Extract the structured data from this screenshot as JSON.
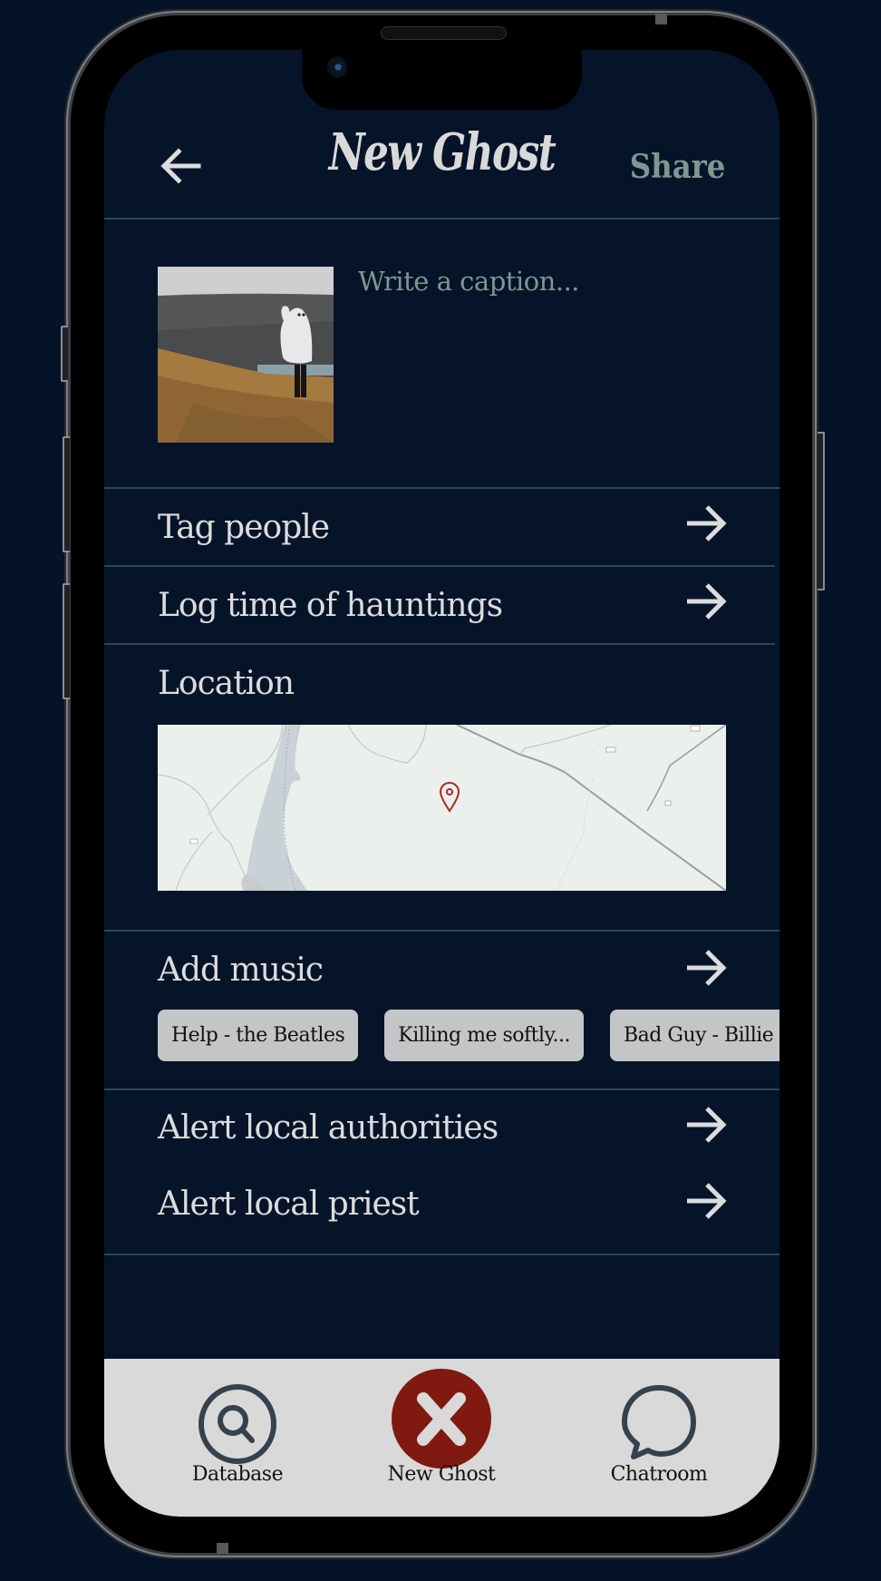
{
  "header": {
    "title": "New Ghost",
    "share_label": "Share",
    "back_icon": "arrow-left-icon"
  },
  "post": {
    "caption_placeholder": "Write a caption...",
    "caption_value": "",
    "thumbnail_alt": "Person in a white sheet ghost costume on a grassy hill"
  },
  "rows": {
    "tag_people": "Tag people",
    "log_time": "Log time of hauntings",
    "location": "Location",
    "add_music": "Add music",
    "alert_authorities": "Alert local authorities",
    "alert_priest": "Alert local priest"
  },
  "music": {
    "chips": [
      "Help - the Beatles",
      "Killing me softly...",
      "Bad Guy - Billie Eilish"
    ]
  },
  "map": {
    "marker_icon": "map-pin-icon",
    "marker_color": "#b3261e"
  },
  "nav": {
    "items": [
      {
        "label": "Database",
        "icon": "search-icon"
      },
      {
        "label": "New Ghost",
        "icon": "close-icon",
        "active": true
      },
      {
        "label": "Chatroom",
        "icon": "chat-bubble-icon"
      }
    ],
    "active_color": "#801a10",
    "icon_color": "#34424f"
  },
  "colors": {
    "background": "#051329",
    "text": "#dcdcdc",
    "muted_green": "#7f978f",
    "divider": "#2f4457",
    "navbar": "#d9d9d9"
  }
}
